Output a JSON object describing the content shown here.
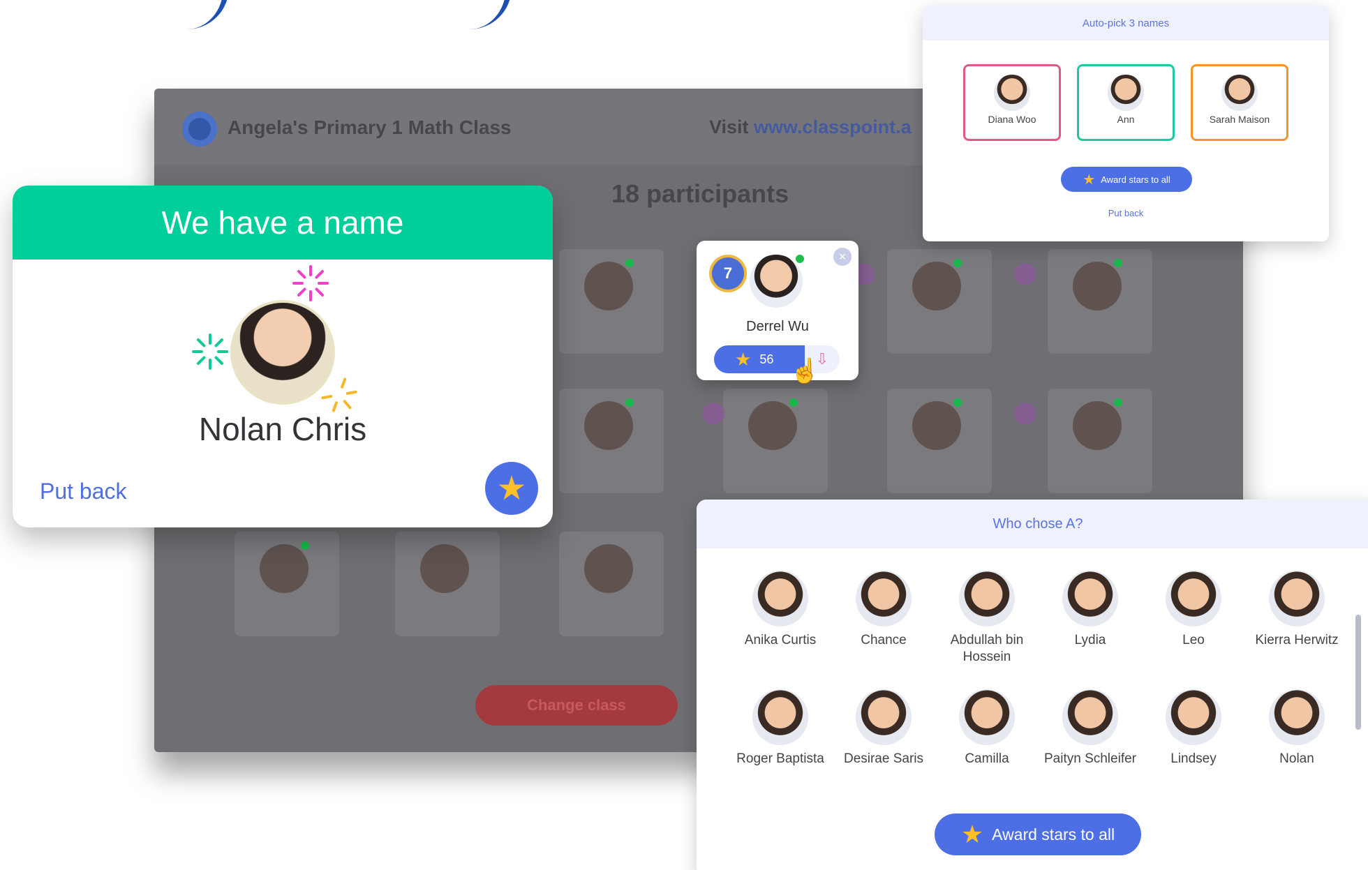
{
  "class_window": {
    "title": "Angela's Primary 1 Math Class",
    "visit_label": "Visit ",
    "visit_link": "www.classpoint.a",
    "participants": "18 participants",
    "change_class": "Change class"
  },
  "name_card": {
    "header": "We have a name",
    "name": "Nolan Chris",
    "put_back": "Put back",
    "star_icon": "star-icon"
  },
  "derrel_card": {
    "level": "7",
    "name": "Derrel Wu",
    "stars": "56",
    "close_icon": "×",
    "down_icon": "⇩"
  },
  "autopick": {
    "header": "Auto-pick 3 names",
    "picks": [
      {
        "name": "Diana Woo",
        "border": "#e05a88"
      },
      {
        "name": "Ann",
        "border": "#1fc9a0"
      },
      {
        "name": "Sarah Maison",
        "border": "#f0962a"
      }
    ],
    "award_label": "Award stars to all",
    "put_back": "Put back"
  },
  "who_chose": {
    "header": "Who chose A?",
    "students": [
      {
        "name": "Anika Curtis"
      },
      {
        "name": "Chance"
      },
      {
        "name": "Abdullah bin Hossein"
      },
      {
        "name": "Lydia"
      },
      {
        "name": "Leo"
      },
      {
        "name": "Kierra Herwitz"
      },
      {
        "name": "Roger Baptista"
      },
      {
        "name": "Desirae Saris"
      },
      {
        "name": "Camilla"
      },
      {
        "name": "Paityn Schleifer"
      },
      {
        "name": "Lindsey"
      },
      {
        "name": "Nolan"
      }
    ],
    "award_label": "Award stars to all"
  },
  "colors": {
    "accent_green": "#00cf9b",
    "accent_blue": "#4d6fe6",
    "star_gold": "#ffbf26"
  }
}
